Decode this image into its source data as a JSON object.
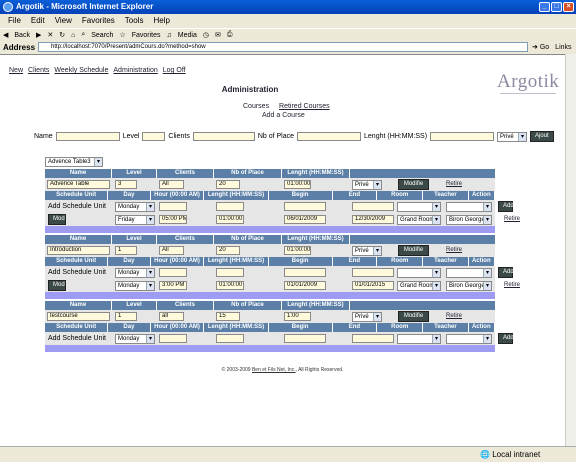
{
  "window": {
    "title": "Argotik - Microsoft Internet Explorer"
  },
  "menu": [
    "File",
    "Edit",
    "View",
    "Favorites",
    "Tools",
    "Help"
  ],
  "toolbar": {
    "back": "Back",
    "search": "Search",
    "favorites": "Favorites",
    "media": "Media"
  },
  "address": {
    "label": "Address",
    "url": "http://localhost:7070/Present/admCours.do?method=show",
    "go": "Go",
    "links": "Links"
  },
  "status": {
    "zone": "Local intranet"
  },
  "nav": [
    "New",
    "Clients",
    "Weekly Schedule",
    "Administration",
    "Log Off"
  ],
  "logo": "Argotik",
  "page_title": "Administration",
  "subnav": {
    "courses": "Courses",
    "retired": "Retired Courses",
    "add": "Add a Course"
  },
  "add_form": {
    "name": "Name",
    "level": "Level",
    "clients": "Clients",
    "nb": "Nb of Place",
    "lenght": "Lenght (HH:MM:SS)",
    "type": "Privé",
    "button": "Ajout"
  },
  "table_select": "Advence Table3",
  "course_headers": [
    "Name",
    "Level",
    "Clients",
    "Nb of Place",
    "Lenght (HH:MM:SS)"
  ],
  "schedule_headers": [
    "Schedule Unit",
    "Day",
    "Hour (00:00 AM)",
    "Lenght (HH:MM:SS)",
    "Begin",
    "End",
    "Room",
    "Teacher",
    "Action"
  ],
  "labels": {
    "add_unit": "Add Schedule Unit",
    "modify": "Modifie",
    "retire": "Retire",
    "add": "Add",
    "mod": "Mod"
  },
  "courses": [
    {
      "name": "Advence Table",
      "level": "3",
      "clients": "All",
      "nb": "20",
      "lenght": "01:00:00",
      "type": "Privé",
      "add_day": "Monday",
      "units": [
        {
          "day": "Friday",
          "hour": "05:00 PM",
          "lenght": "01:00:00",
          "begin": "06/01/2009",
          "end": "12/30/2009",
          "room": "Grand Room",
          "teacher": "Biron George"
        }
      ]
    },
    {
      "name": "Introduction",
      "level": "1",
      "clients": "All",
      "nb": "20",
      "lenght": "01:00:00",
      "type": "Privé",
      "add_day": "Monday",
      "units": [
        {
          "day": "Monday",
          "hour": "3:00 PM",
          "lenght": "01:00:00",
          "begin": "01/01/2009",
          "end": "01/01/2015",
          "room": "Grand Room",
          "teacher": "Biron George"
        }
      ]
    },
    {
      "name": "testcourse",
      "level": "1",
      "clients": "all",
      "nb": "15",
      "lenght": "1:00",
      "type": "Privé",
      "add_day": "Monday",
      "units": []
    }
  ],
  "footer": {
    "pre": "© 2003-2009 ",
    "company": "Ben et Fils Net, Inc.",
    "post": ", All Rights Reserved."
  }
}
